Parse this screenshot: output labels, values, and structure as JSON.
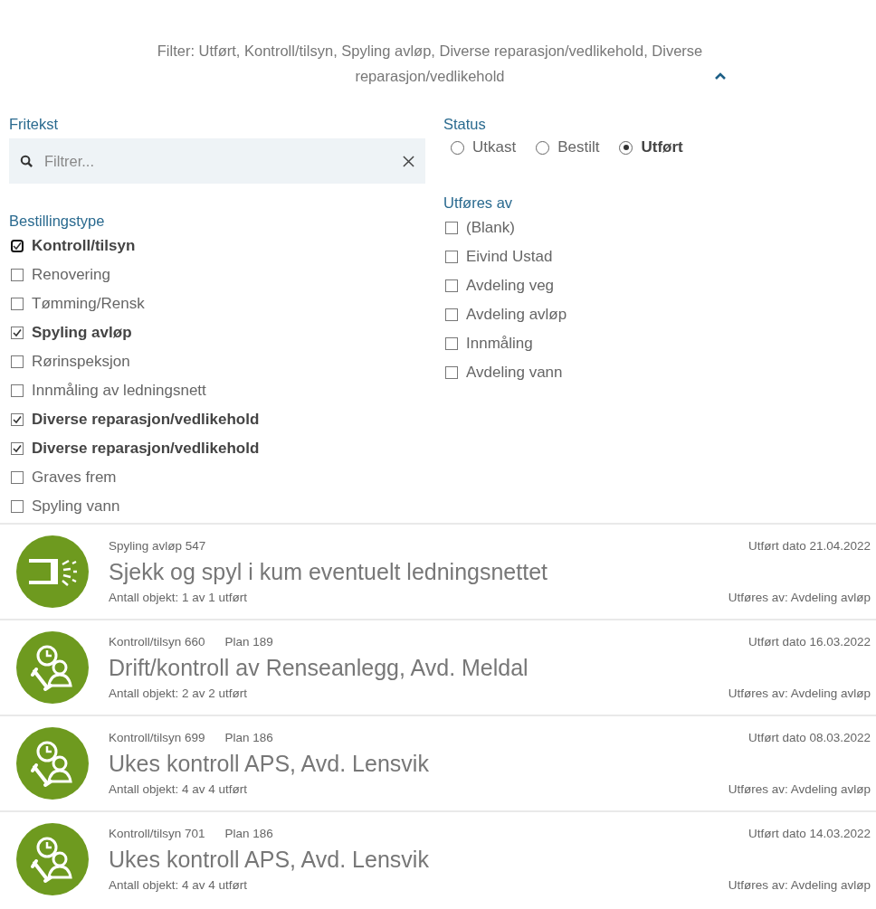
{
  "filter_summary": {
    "text": "Filter: Utført, Kontroll/tilsyn, Spyling avløp, Diverse reparasjon/vedlikehold, Diverse reparasjon/vedlikehold",
    "expanded": true
  },
  "fritekst": {
    "label": "Fritekst",
    "placeholder": "Filtrer..."
  },
  "status": {
    "label": "Status",
    "options": [
      {
        "label": "Utkast",
        "selected": false
      },
      {
        "label": "Bestilt",
        "selected": false
      },
      {
        "label": "Utført",
        "selected": true
      }
    ]
  },
  "bestillingstype": {
    "label": "Bestillingstype",
    "items": [
      {
        "label": "Kontroll/tilsyn",
        "checked": true,
        "focused": true
      },
      {
        "label": "Renovering",
        "checked": false,
        "focused": false
      },
      {
        "label": "Tømming/Rensk",
        "checked": false,
        "focused": false
      },
      {
        "label": "Spyling avløp",
        "checked": true,
        "focused": false
      },
      {
        "label": "Rørinspeksjon",
        "checked": false,
        "focused": false
      },
      {
        "label": "Innmåling av ledningsnett",
        "checked": false,
        "focused": false
      },
      {
        "label": "Diverse reparasjon/vedlikehold",
        "checked": true,
        "focused": false
      },
      {
        "label": "Diverse reparasjon/vedlikehold",
        "checked": true,
        "focused": false
      },
      {
        "label": "Graves frem",
        "checked": false,
        "focused": false
      },
      {
        "label": "Spyling vann",
        "checked": false,
        "focused": false
      }
    ]
  },
  "utfores_av": {
    "label": "Utføres av",
    "items": [
      {
        "label": "(Blank)",
        "checked": false
      },
      {
        "label": "Eivind Ustad",
        "checked": false
      },
      {
        "label": "Avdeling veg",
        "checked": false
      },
      {
        "label": "Avdeling avløp",
        "checked": false
      },
      {
        "label": "Innmåling",
        "checked": false
      },
      {
        "label": "Avdeling vann",
        "checked": false
      }
    ]
  },
  "orders": [
    {
      "kind": "spray",
      "type": "Spyling avløp 547",
      "title": "Sjekk og spyl i kum eventuelt ledningsnettet",
      "date": "Utført dato 21.04.2022",
      "count": "Antall objekt: 1 av 1 utført",
      "performer": "Utføres av: Avdeling avløp"
    },
    {
      "kind": "maintenance",
      "type": "Kontroll/tilsyn 660",
      "plan": "Plan 189",
      "title": "Drift/kontroll av Renseanlegg, Avd. Meldal",
      "date": "Utført dato 16.03.2022",
      "count": "Antall objekt: 2 av 2 utført",
      "performer": "Utføres av: Avdeling avløp"
    },
    {
      "kind": "maintenance",
      "type": "Kontroll/tilsyn 699",
      "plan": "Plan 186",
      "title": "Ukes kontroll APS, Avd. Lensvik",
      "date": "Utført dato 08.03.2022",
      "count": "Antall objekt: 4 av 4 utført",
      "performer": "Utføres av: Avdeling avløp"
    },
    {
      "kind": "maintenance",
      "type": "Kontroll/tilsyn 701",
      "plan": "Plan 186",
      "title": "Ukes kontroll APS, Avd. Lensvik",
      "date": "Utført dato 14.03.2022",
      "count": "Antall objekt: 4 av 4 utført",
      "performer": "Utføres av: Avdeling avløp"
    }
  ]
}
